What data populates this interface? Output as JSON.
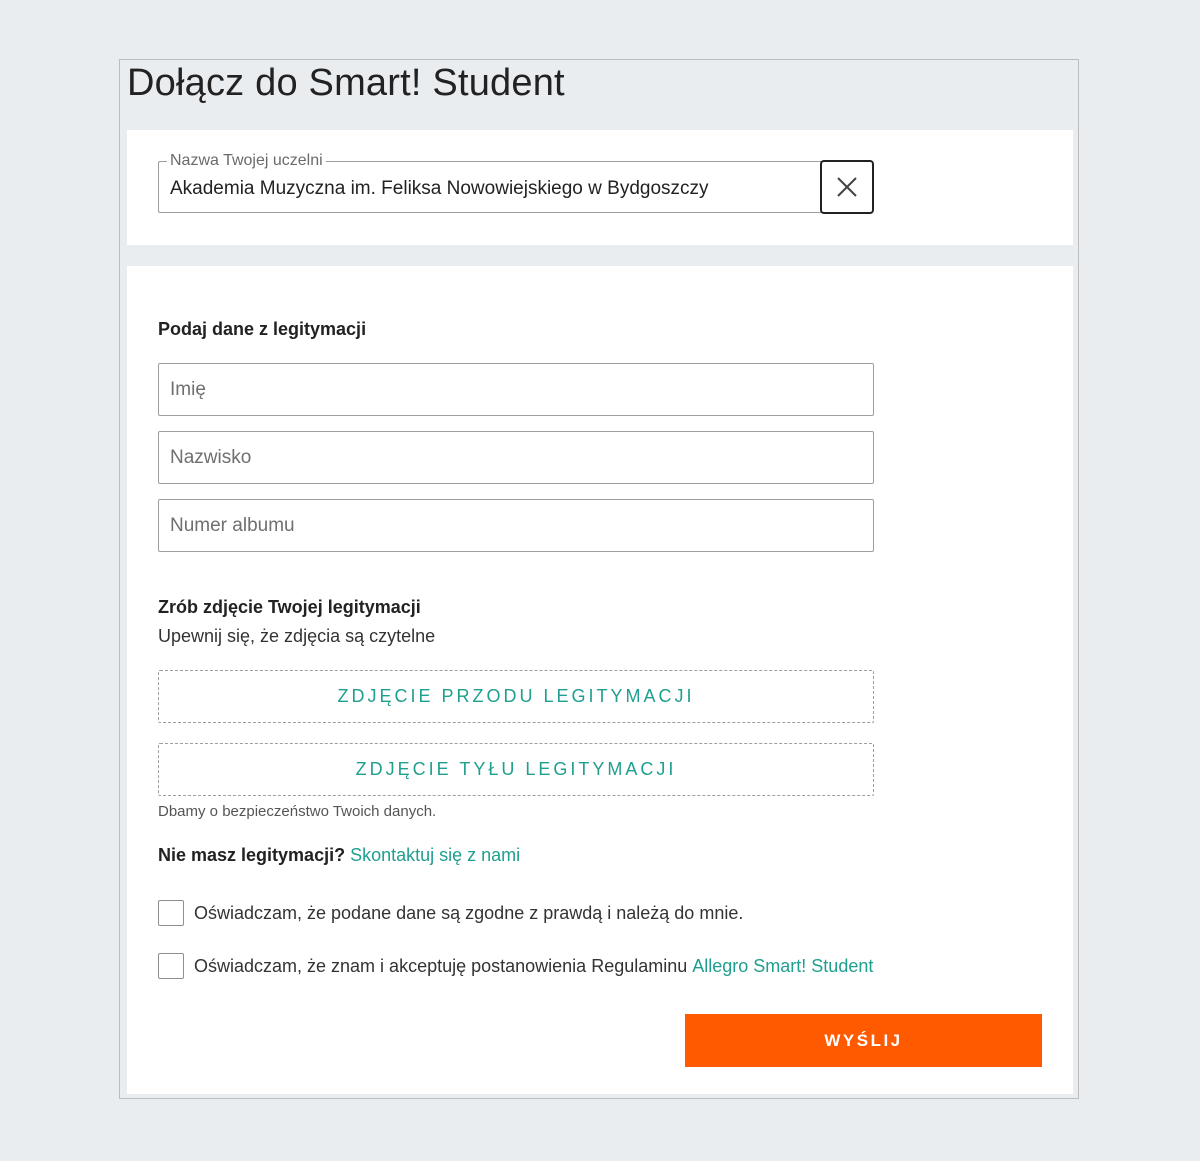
{
  "page": {
    "title": "Dołącz do Smart! Student"
  },
  "university": {
    "legend": "Nazwa Twojej uczelni",
    "value": "Akademia Muzyczna im. Feliksa Nowowiejskiego w Bydgoszczy",
    "clear_icon": "close-icon"
  },
  "id_data": {
    "heading": "Podaj dane z legitymacji",
    "first_name_placeholder": "Imię",
    "last_name_placeholder": "Nazwisko",
    "album_placeholder": "Numer albumu"
  },
  "photo": {
    "heading": "Zrób zdjęcie Twojej legitymacji",
    "subtitle": "Upewnij się, że zdjęcia są czytelne",
    "front_label": "ZDJĘCIE PRZODU LEGITYMACJI",
    "back_label": "ZDJĘCIE TYŁU LEGITYMACJI",
    "privacy_note": "Dbamy o bezpieczeństwo Twoich danych."
  },
  "contact": {
    "question": "Nie masz legitymacji?",
    "link": "Skontaktuj się z nami"
  },
  "consents": {
    "truth_label": "Oświadczam, że podane dane są zgodne z prawdą i należą do mnie.",
    "terms_label": "Oświadczam, że znam i akceptuję postanowienia Regulaminu",
    "terms_link": "Allegro Smart! Student"
  },
  "submit": {
    "label": "WYŚLIJ"
  },
  "colors": {
    "accent": "#1f9f8e",
    "primary_button": "#ff5a00",
    "background": "#e9edf0"
  }
}
